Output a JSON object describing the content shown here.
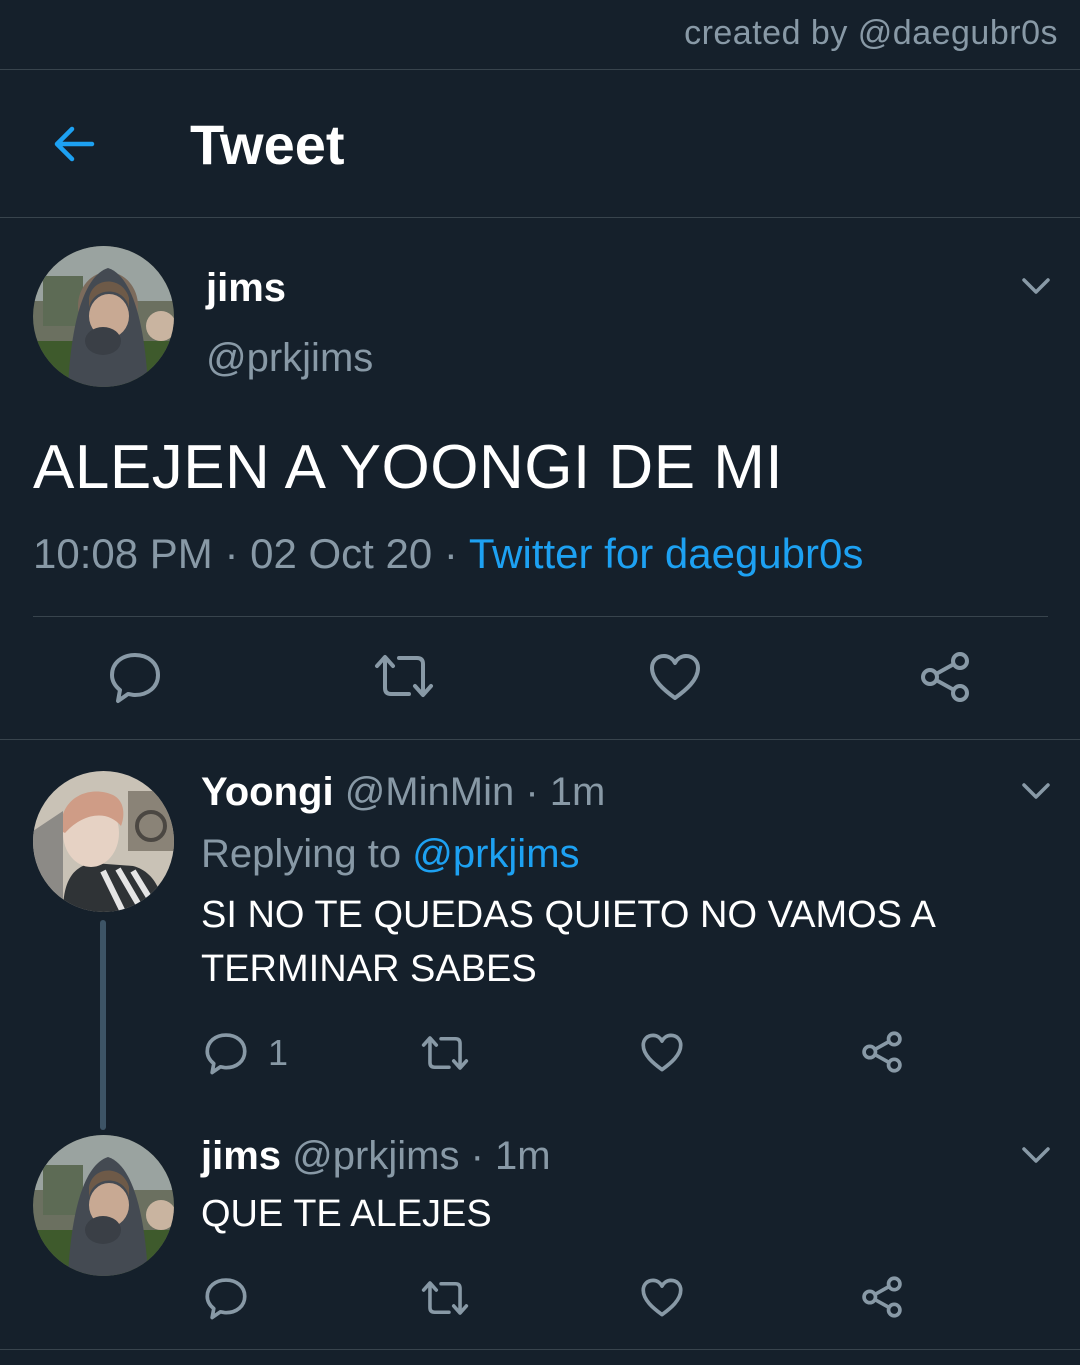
{
  "credit": "created by @daegubr0s",
  "header": {
    "title": "Tweet"
  },
  "main_tweet": {
    "name": "jims",
    "handle": "@prkjims",
    "text": "ALEJEN A YOONGI DE MI",
    "time": "10:08 PM",
    "date": "02 Oct 20",
    "source": "Twitter for daegubr0s",
    "separator": "·"
  },
  "replies": [
    {
      "name": "Yoongi",
      "handle": "@MinMin",
      "time": "· 1m",
      "replying_prefix": "Replying to",
      "replying_to": "@prkjims",
      "text": "SI NO TE QUEDAS QUIETO NO VAMOS A TERMINAR SABES",
      "reply_count": "1"
    },
    {
      "name": "jims",
      "handle": "@prkjims",
      "time": "· 1m",
      "text": "QUE TE ALEJES"
    }
  ],
  "colors": {
    "background": "#15202b",
    "accent": "#1da1f2",
    "muted": "#8899a6",
    "divider": "#38444d"
  },
  "icons": [
    "back-arrow-icon",
    "chevron-down-icon",
    "comment-icon",
    "retweet-icon",
    "heart-icon",
    "share-icon"
  ]
}
